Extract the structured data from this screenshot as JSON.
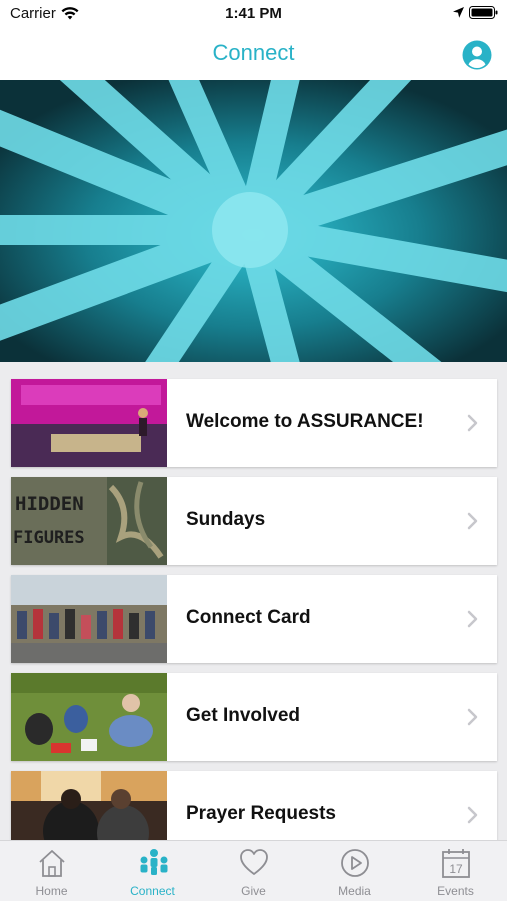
{
  "status_bar": {
    "carrier": "Carrier",
    "time": "1:41 PM"
  },
  "header": {
    "title": "Connect",
    "profile_icon": "person-icon"
  },
  "hero": {
    "icon": "hands-together-photo"
  },
  "cards": [
    {
      "title": "Welcome to ASSURANCE!",
      "thumb": "stage-photo"
    },
    {
      "title": "Sundays",
      "thumb": "hidden-figures-photo",
      "thumb_text": [
        "HIDDEN",
        "FIGURES"
      ]
    },
    {
      "title": "Connect Card",
      "thumb": "group-photo"
    },
    {
      "title": "Get Involved",
      "thumb": "outdoor-group-photo"
    },
    {
      "title": "Prayer Requests",
      "thumb": "prayer-photo"
    }
  ],
  "tabs": [
    {
      "label": "Home",
      "icon": "home-icon",
      "active": false
    },
    {
      "label": "Connect",
      "icon": "people-icon",
      "active": true
    },
    {
      "label": "Give",
      "icon": "heart-icon",
      "active": false
    },
    {
      "label": "Media",
      "icon": "play-icon",
      "active": false
    },
    {
      "label": "Events",
      "icon": "calendar-icon",
      "active": false,
      "badge": "17"
    }
  ],
  "colors": {
    "accent": "#29b2c7",
    "inactive": "#8e8e93",
    "hero_tint": "#1fb5c6"
  }
}
